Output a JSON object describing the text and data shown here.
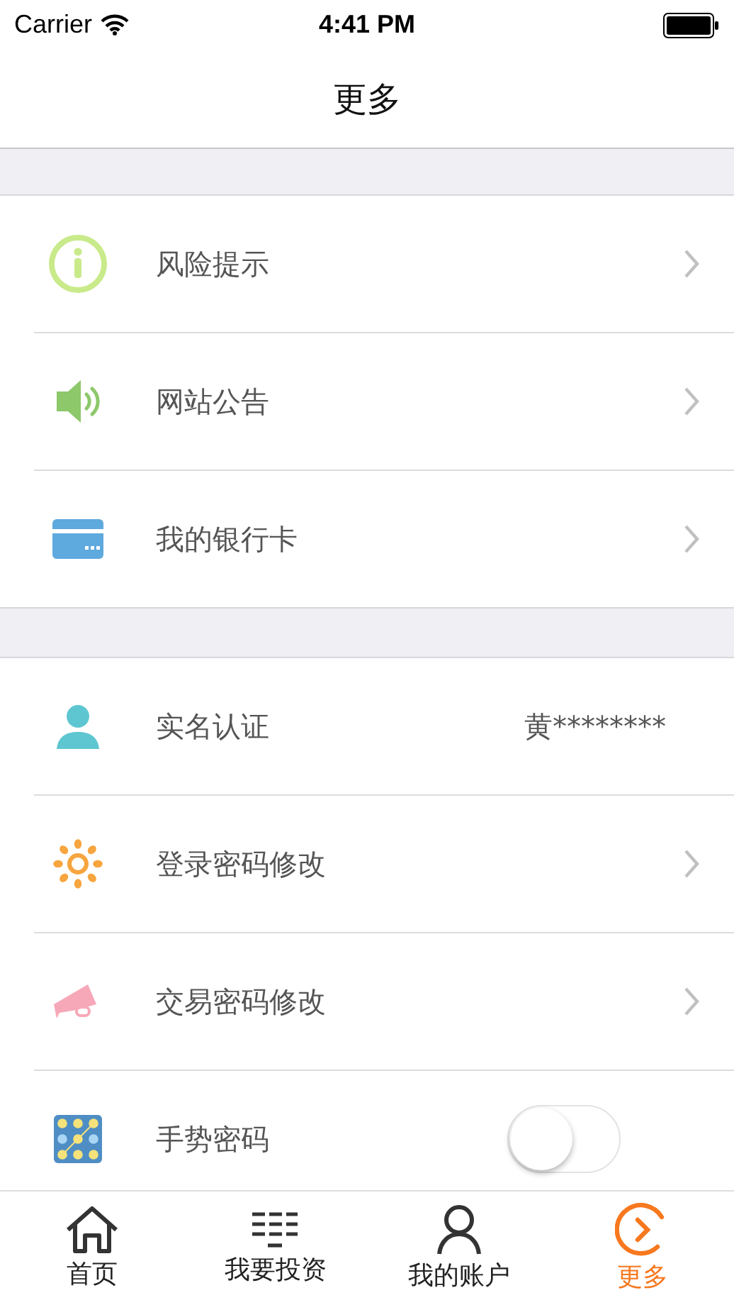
{
  "status_bar": {
    "carrier": "Carrier",
    "time": "4:41 PM"
  },
  "nav_bar": {
    "title": "更多"
  },
  "sections": [
    {
      "rows": [
        {
          "kind": "link",
          "label": "风险提示"
        },
        {
          "kind": "link",
          "label": "网站公告"
        },
        {
          "kind": "link",
          "label": "我的银行卡"
        }
      ]
    },
    {
      "rows": [
        {
          "kind": "value",
          "label": "实名认证",
          "value": "黄********"
        },
        {
          "kind": "link",
          "label": "登录密码修改"
        },
        {
          "kind": "link",
          "label": "交易密码修改"
        },
        {
          "kind": "toggle",
          "label": "手势密码",
          "on": false
        }
      ]
    }
  ],
  "tab_bar": [
    {
      "label": "首页",
      "selected": false
    },
    {
      "label": "我要投资",
      "selected": false
    },
    {
      "label": "我的账户",
      "selected": false
    },
    {
      "label": "更多",
      "selected": true
    }
  ]
}
